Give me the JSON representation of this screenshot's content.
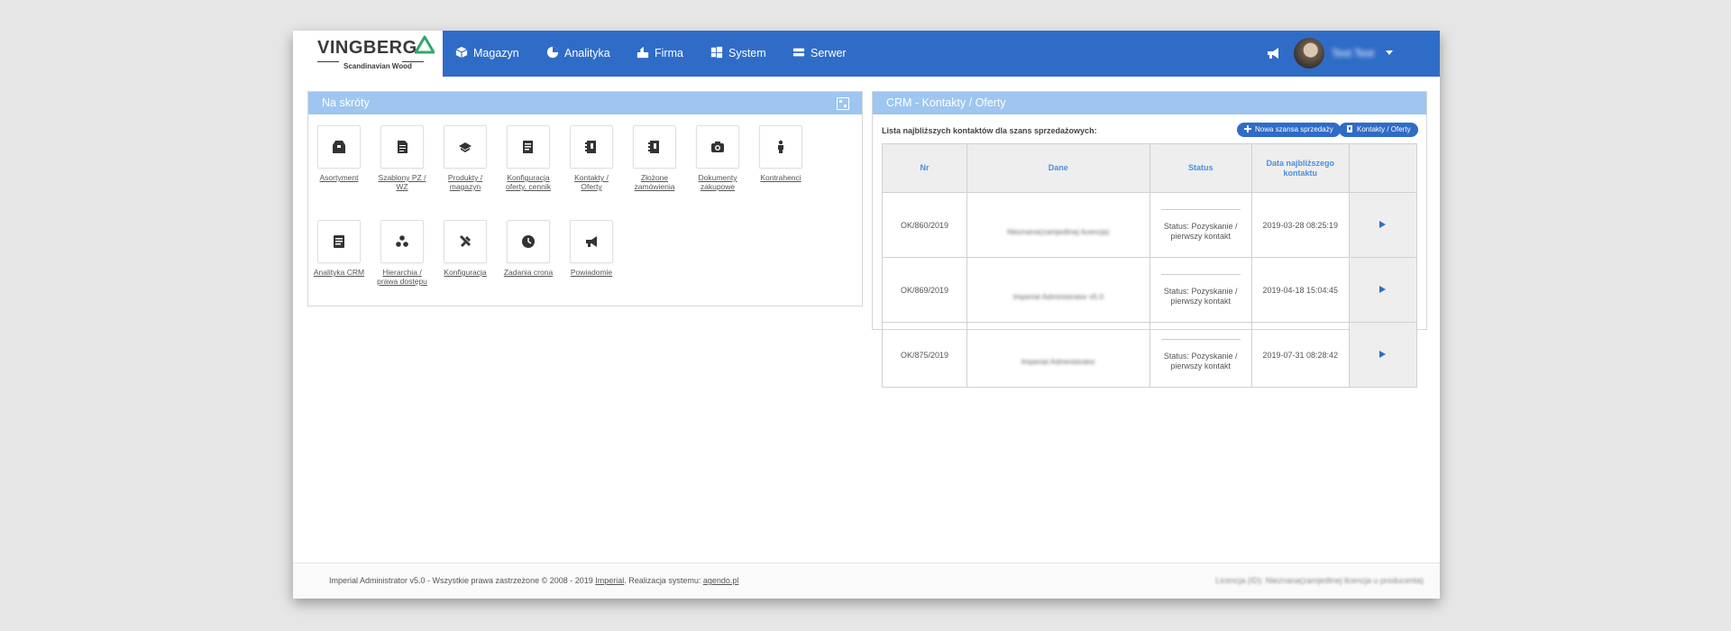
{
  "brand": {
    "name": "VINGBERG",
    "tagline": "Scandinavian Wood",
    "accent": "#2fa86a"
  },
  "nav": {
    "items": [
      {
        "label": "Magazyn",
        "icon": "cube-icon"
      },
      {
        "label": "Analityka",
        "icon": "chart-pie-icon"
      },
      {
        "label": "Firma",
        "icon": "building-icon"
      },
      {
        "label": "System",
        "icon": "windows-icon"
      },
      {
        "label": "Serwer",
        "icon": "server-icon"
      }
    ],
    "user_name": "Test Test",
    "bar_color": "#2f6cc8"
  },
  "shortcuts": {
    "title": "Na skróty",
    "tiles": [
      {
        "label": "Asortyment",
        "icon": "box-icon"
      },
      {
        "label": "Szablony PZ / WZ",
        "icon": "document-icon"
      },
      {
        "label": "Produkty / magazyn",
        "icon": "layers-icon"
      },
      {
        "label": "Konfiguracja oferty, cennik",
        "icon": "list-icon"
      },
      {
        "label": "Kontakty / Oferty",
        "icon": "address-book-icon"
      },
      {
        "label": "Złożone zamówienia",
        "icon": "address-book-icon"
      },
      {
        "label": "Dokumenty zakupowe",
        "icon": "camera-icon"
      },
      {
        "label": "Kontrahenci",
        "icon": "person-icon"
      },
      {
        "label": "Analityka CRM",
        "icon": "report-icon"
      },
      {
        "label": "Hierarchia / prawa dostępu",
        "icon": "hierarchy-icon"
      },
      {
        "label": "Konfiguracja",
        "icon": "tools-icon"
      },
      {
        "label": "Zadania crona",
        "icon": "clock-icon"
      },
      {
        "label": "Powiadomie",
        "icon": "megaphone-icon"
      }
    ]
  },
  "crm": {
    "title": "CRM - Kontakty / Oferty",
    "subtitle": "Lista najbliższych kontaktów dla szans sprzedażowych:",
    "btn_new": "Nowa szansa sprzedaży",
    "btn_contacts": "Kontakty / Oferty",
    "columns": [
      "Nr",
      "Dane",
      "Status",
      "Data najbliższego kontaktu",
      ""
    ],
    "rows": [
      {
        "nr": "OK/860/2019",
        "dane": "Nieznana(zamjedtnej licencja)",
        "status": "Status: Pozyskanie / pierwszy kontakt",
        "date": "2019-03-28 08:25:19"
      },
      {
        "nr": "OK/869/2019",
        "dane": "Imperial Administrator v5.0",
        "status": "Status: Pozyskanie / pierwszy kontakt",
        "date": "2019-04-18 15:04:45"
      },
      {
        "nr": "OK/875/2019",
        "dane": "Imperial Administrator",
        "status": "Status: Pozyskanie / pierwszy kontakt",
        "date": "2019-07-31 08:28:42"
      }
    ]
  },
  "footer": {
    "text": "Imperial Administrator v5.0 - Wszystkie prawa zastrzeżone © 2008 - 2019",
    "link1": "Imperial",
    "mid": ". Realizacja systemu:",
    "link2": "agendo.pl",
    "license": "Licencja (ID): Nieznana(zamjedtnej licencja u producenta)"
  }
}
